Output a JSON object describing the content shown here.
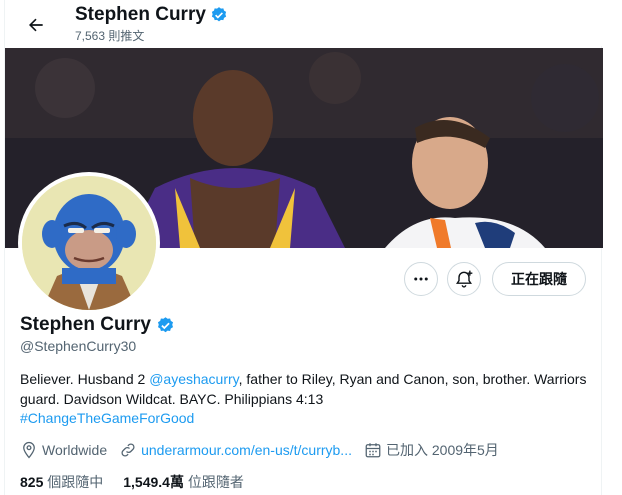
{
  "header": {
    "name": "Stephen Curry",
    "tweet_count": "7,563 則推文"
  },
  "profile": {
    "name": "Stephen Curry",
    "handle": "@StephenCurry30",
    "follow_label": "正在跟隨",
    "bio": {
      "part1": "Believer. Husband 2 ",
      "mention": "@ayeshacurry",
      "part2": ", father to Riley, Ryan and Canon, son, brother. Warriors guard. Davidson Wildcat. BAYC. Philippians 4:13",
      "hashtag": "#ChangeTheGameForGood"
    },
    "location": "Worldwide",
    "url": "underarmour.com/en-us/t/curryb...",
    "joined": "已加入 2009年5月",
    "following_count": "825",
    "following_label": "個跟隨中",
    "followers_count": "1,549.4萬",
    "followers_label": "位跟隨者"
  },
  "icons": {
    "back": "arrow-left-icon",
    "verified": "verified-badge-icon",
    "more": "more-dots-icon",
    "notify": "bell-plus-icon",
    "location": "location-pin-icon",
    "link": "link-icon",
    "calendar": "calendar-icon"
  },
  "colors": {
    "accent": "#1d9bf0",
    "text": "#0f1419",
    "secondary": "#536471"
  }
}
